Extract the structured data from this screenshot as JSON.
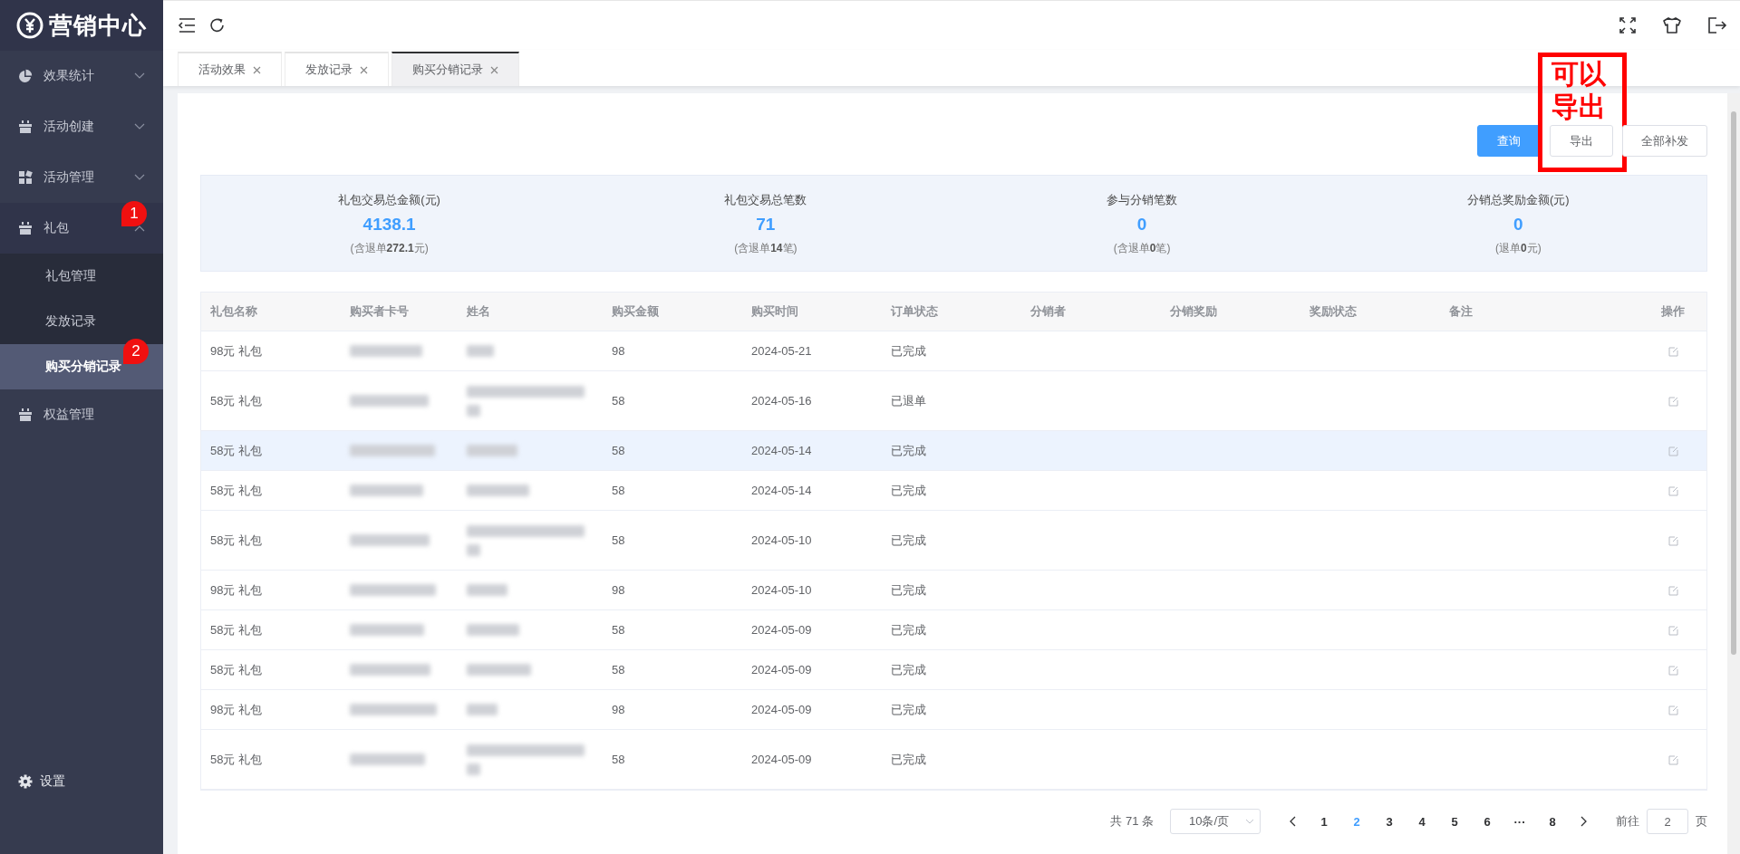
{
  "logo": {
    "title": "营销中心"
  },
  "sidebar": {
    "items": [
      {
        "label": "效果统计",
        "expanded": false
      },
      {
        "label": "活动创建",
        "expanded": false
      },
      {
        "label": "活动管理",
        "expanded": false
      },
      {
        "label": "礼包",
        "expanded": true,
        "badge": "1",
        "children": [
          {
            "label": "礼包管理",
            "selected": false
          },
          {
            "label": "发放记录",
            "selected": false
          },
          {
            "label": "购买分销记录",
            "selected": true,
            "badge": "2"
          }
        ]
      },
      {
        "label": "权益管理"
      }
    ],
    "footer": {
      "label": "设置"
    }
  },
  "tabs": [
    {
      "label": "活动效果",
      "selected": false
    },
    {
      "label": "发放记录",
      "selected": false
    },
    {
      "label": "购买分销记录",
      "selected": true
    }
  ],
  "buttons": [
    {
      "label": "查询",
      "kind": "primary"
    },
    {
      "label": "导出",
      "kind": "plain",
      "callout": "可以导出"
    },
    {
      "label": "全部补发",
      "kind": "plain"
    }
  ],
  "stats": [
    {
      "label": "礼包交易总金额(元)",
      "value": "4138.1",
      "note": "(含退单**272.1**元)"
    },
    {
      "label": "礼包交易总笔数",
      "value": "71",
      "note": "(含退单**14**笔)"
    },
    {
      "label": "参与分销笔数",
      "value": "0",
      "note": "(含退单**0**笔)"
    },
    {
      "label": "分销总奖励金额(元)",
      "value": "0",
      "note": "(退单**0**元)"
    }
  ],
  "table": {
    "columns": [
      "礼包名称",
      "购买者卡号",
      "姓名",
      "购买金额",
      "购买时间",
      "订单状态",
      "分销者",
      "分销奖励",
      "奖励状态",
      "备注",
      "操作"
    ],
    "rows": [
      {
        "package": "98元 礼包",
        "name_wrapped": false,
        "amount": "98",
        "time": "2024-05-21",
        "status": "已完成",
        "selected": false
      },
      {
        "package": "58元 礼包",
        "name_wrapped": true,
        "amount": "58",
        "time": "2024-05-16",
        "status": "已退单",
        "selected": false
      },
      {
        "package": "58元 礼包",
        "name_wrapped": false,
        "amount": "58",
        "time": "2024-05-14",
        "status": "已完成",
        "selected": true
      },
      {
        "package": "58元 礼包",
        "name_wrapped": false,
        "amount": "58",
        "time": "2024-05-14",
        "status": "已完成",
        "selected": false
      },
      {
        "package": "58元 礼包",
        "name_wrapped": true,
        "amount": "58",
        "time": "2024-05-10",
        "status": "已完成",
        "selected": false
      },
      {
        "package": "98元 礼包",
        "name_wrapped": false,
        "amount": "98",
        "time": "2024-05-10",
        "status": "已完成",
        "selected": false
      },
      {
        "package": "58元 礼包",
        "name_wrapped": false,
        "amount": "58",
        "time": "2024-05-09",
        "status": "已完成",
        "selected": false
      },
      {
        "package": "58元 礼包",
        "name_wrapped": false,
        "amount": "58",
        "time": "2024-05-09",
        "status": "已完成",
        "selected": false
      },
      {
        "package": "98元 礼包",
        "name_wrapped": false,
        "amount": "98",
        "time": "2024-05-09",
        "status": "已完成",
        "selected": false
      },
      {
        "package": "58元 礼包",
        "name_wrapped": true,
        "amount": "58",
        "time": "2024-05-09",
        "status": "已完成",
        "selected": false
      }
    ]
  },
  "pagination": {
    "total": "共 71 条",
    "page_size": "10条/页",
    "pages": [
      {
        "label": "1",
        "selected": false
      },
      {
        "label": "2",
        "selected": true
      },
      {
        "label": "3",
        "selected": false
      },
      {
        "label": "4",
        "selected": false
      },
      {
        "label": "5",
        "selected": false
      },
      {
        "label": "6",
        "selected": false
      },
      {
        "label": "···",
        "selected": false
      },
      {
        "label": "8",
        "selected": false
      }
    ],
    "goto_label": "前往",
    "goto_value": "2",
    "goto_unit": "页"
  }
}
